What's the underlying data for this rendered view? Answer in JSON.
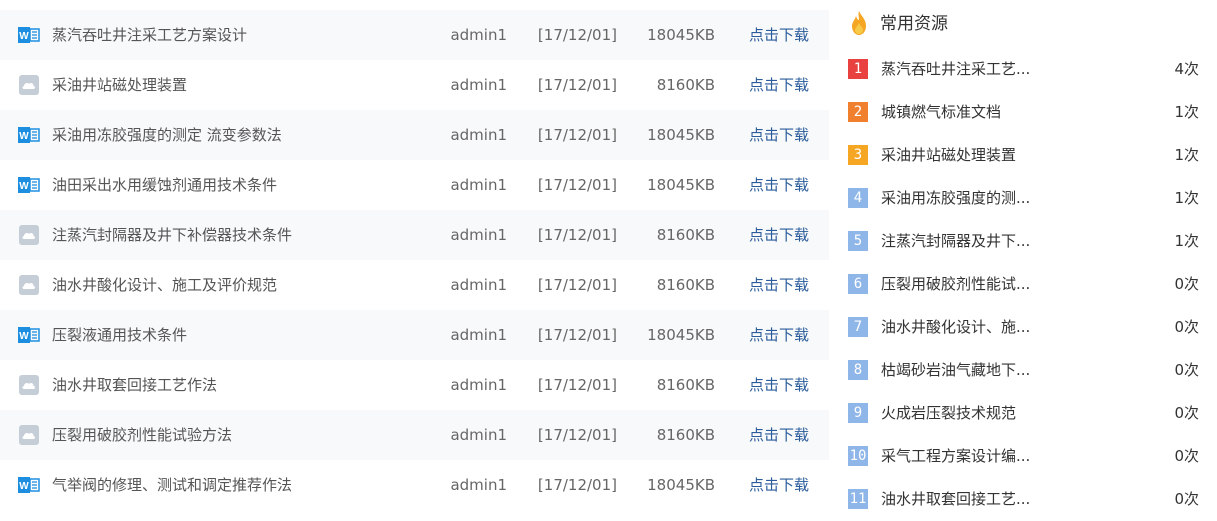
{
  "colors": {
    "rank1": "#e8413f",
    "rank2": "#f07f2e",
    "rank3": "#f5a623",
    "rankOther": "#8fb6e8",
    "link": "#2a5b9a",
    "wordIcon": "#1e8fe0",
    "cloudIcon": "#c5cdd6"
  },
  "download_label": "点击下载",
  "files": [
    {
      "icon": "word-icon",
      "name": "蒸汽吞吐井注采工艺方案设计",
      "user": "admin1",
      "date": "[17/12/01]",
      "size": "18045KB"
    },
    {
      "icon": "cloud-icon",
      "name": "采油井站磁处理装置",
      "user": "admin1",
      "date": "[17/12/01]",
      "size": "8160KB"
    },
    {
      "icon": "word-icon",
      "name": "采油用冻胶强度的测定 流变参数法",
      "user": "admin1",
      "date": "[17/12/01]",
      "size": "18045KB"
    },
    {
      "icon": "word-icon",
      "name": "油田采出水用缓蚀剂通用技术条件",
      "user": "admin1",
      "date": "[17/12/01]",
      "size": "18045KB"
    },
    {
      "icon": "cloud-icon",
      "name": "注蒸汽封隔器及井下补偿器技术条件",
      "user": "admin1",
      "date": "[17/12/01]",
      "size": "8160KB"
    },
    {
      "icon": "cloud-icon",
      "name": "油水井酸化设计、施工及评价规范",
      "user": "admin1",
      "date": "[17/12/01]",
      "size": "8160KB"
    },
    {
      "icon": "word-icon",
      "name": "压裂液通用技术条件",
      "user": "admin1",
      "date": "[17/12/01]",
      "size": "18045KB"
    },
    {
      "icon": "cloud-icon",
      "name": "油水井取套回接工艺作法",
      "user": "admin1",
      "date": "[17/12/01]",
      "size": "8160KB"
    },
    {
      "icon": "cloud-icon",
      "name": "压裂用破胶剂性能试验方法",
      "user": "admin1",
      "date": "[17/12/01]",
      "size": "8160KB"
    },
    {
      "icon": "word-icon",
      "name": "气举阀的修理、测试和调定推荐作法",
      "user": "admin1",
      "date": "[17/12/01]",
      "size": "18045KB"
    }
  ],
  "sidebar": {
    "icon": "fire-icon",
    "title": "常用资源",
    "items": [
      {
        "rank": "1",
        "name": "蒸汽吞吐井注采工艺...",
        "count": "4次"
      },
      {
        "rank": "2",
        "name": "城镇燃气标准文档",
        "count": "1次"
      },
      {
        "rank": "3",
        "name": "采油井站磁处理装置",
        "count": "1次"
      },
      {
        "rank": "4",
        "name": "采油用冻胶强度的测...",
        "count": "1次"
      },
      {
        "rank": "5",
        "name": "注蒸汽封隔器及井下...",
        "count": "1次"
      },
      {
        "rank": "6",
        "name": "压裂用破胶剂性能试...",
        "count": "0次"
      },
      {
        "rank": "7",
        "name": "油水井酸化设计、施...",
        "count": "0次"
      },
      {
        "rank": "8",
        "name": "枯竭砂岩油气藏地下...",
        "count": "0次"
      },
      {
        "rank": "9",
        "name": "火成岩压裂技术规范",
        "count": "0次"
      },
      {
        "rank": "10",
        "name": "采气工程方案设计编...",
        "count": "0次"
      },
      {
        "rank": "11",
        "name": "油水井取套回接工艺...",
        "count": "0次"
      }
    ]
  }
}
